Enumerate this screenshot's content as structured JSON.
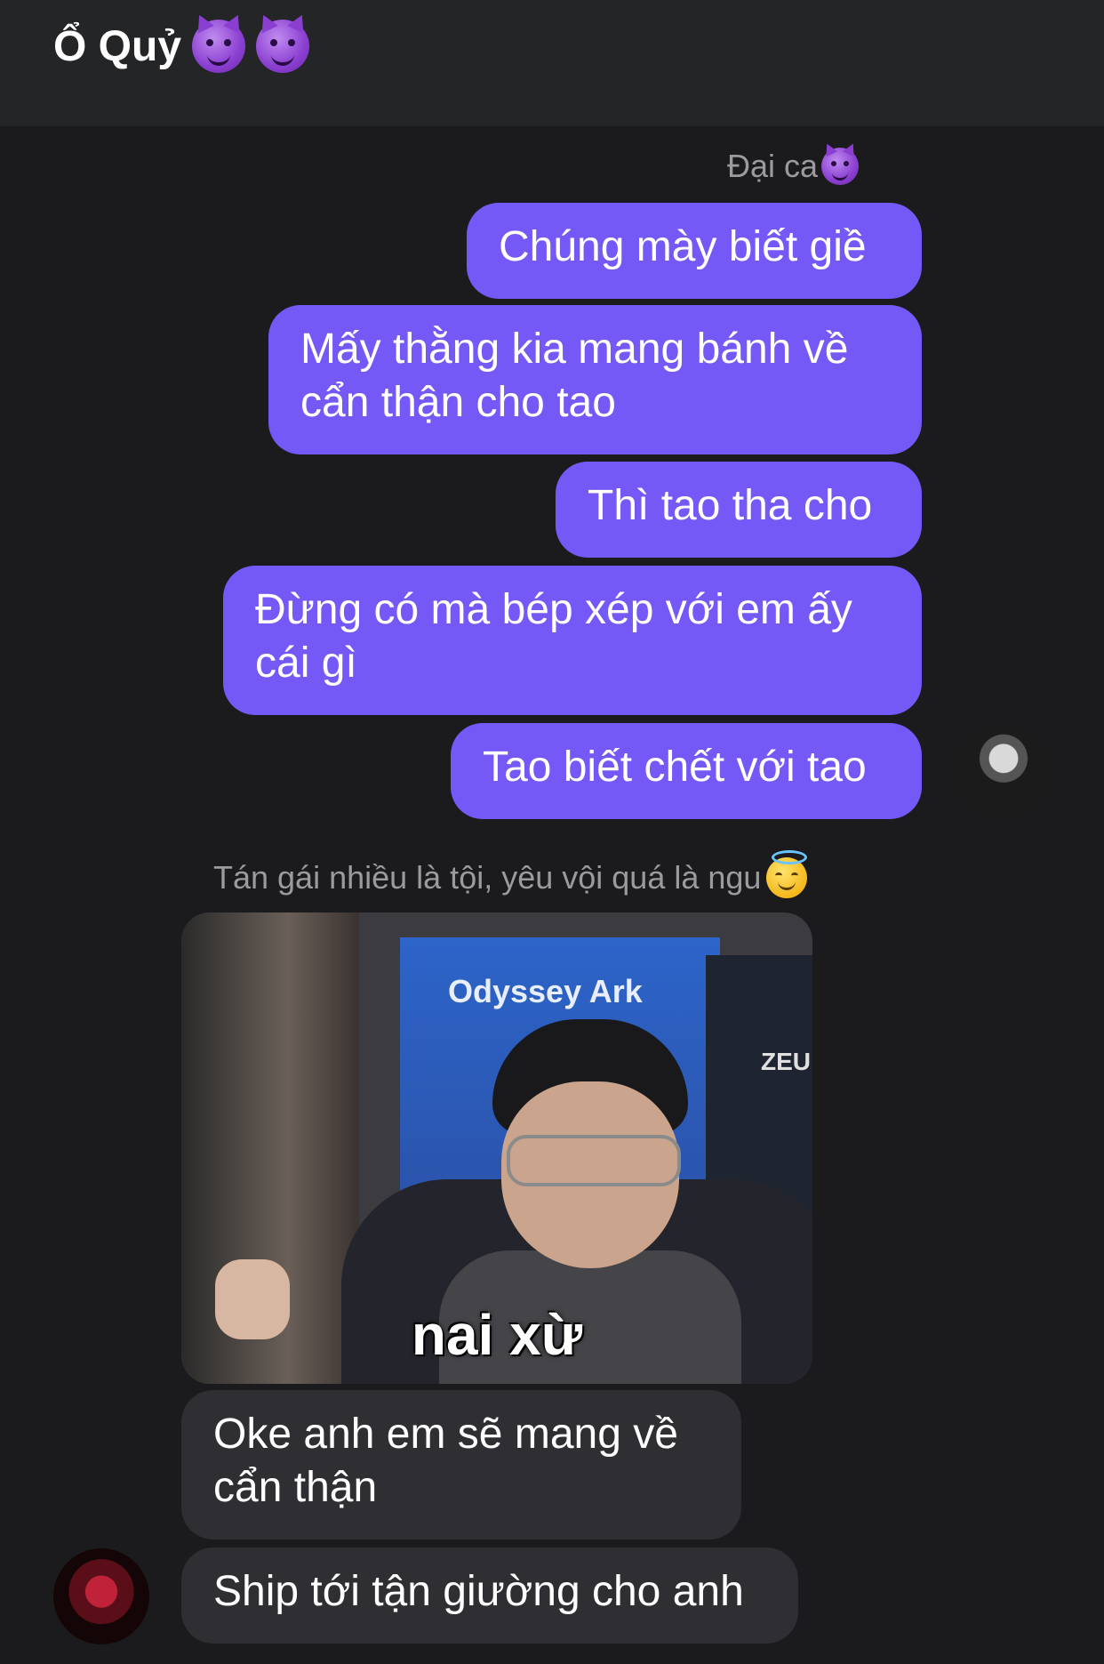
{
  "header": {
    "title": "Ổ Quỷ",
    "title_emojis": [
      "smiling-devil-emoji",
      "smiling-devil-emoji"
    ]
  },
  "messages_out": {
    "sender_name": "Đại ca",
    "bubbles": [
      "Chúng mày biết giề",
      "Mấy thằng kia mang bánh về cẩn thận cho tao",
      "Thì tao tha cho",
      "Đừng có mà bép xép với em ấy cái gì",
      "Tao biết chết với tao"
    ]
  },
  "messages_in": {
    "sender_name": "Tán gái nhiều là tội, yêu vội quá là ngu",
    "photo_caption": "nai xừ",
    "photo_banner_text": "Odyssey Ark",
    "photo_shirt_text": "ZEU",
    "bubbles": [
      "Oke anh em sẽ mang về cẩn thận",
      "Ship tới tận giường cho anh"
    ]
  },
  "colors": {
    "background": "#1b1b1d",
    "header": "#242527",
    "outgoing_bubble": "#7459f6",
    "incoming_bubble": "#2f2f33",
    "sender_label": "#9a9a9f"
  }
}
